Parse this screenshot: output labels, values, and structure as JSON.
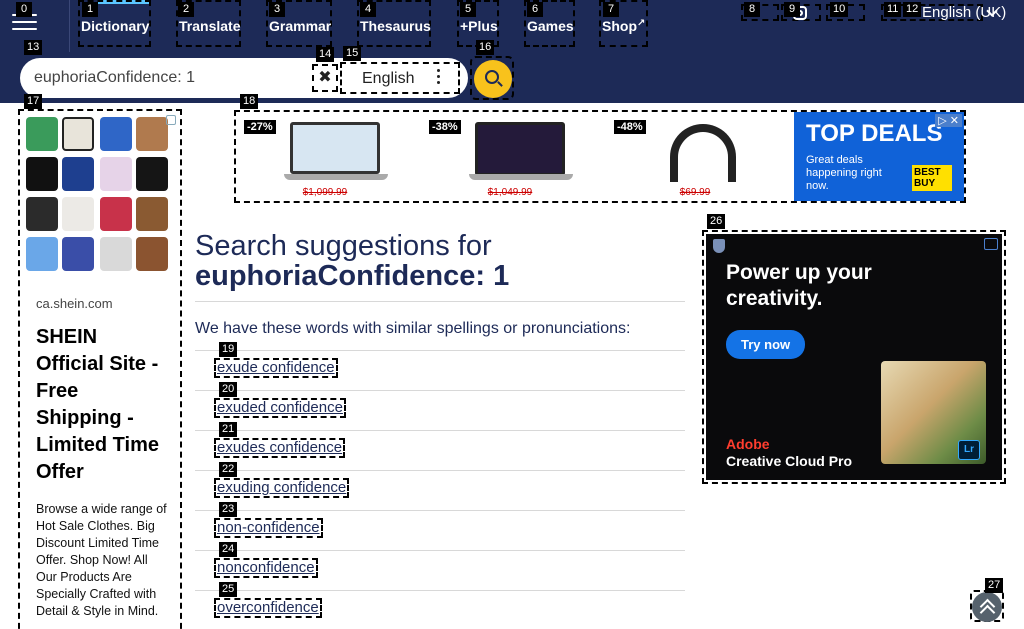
{
  "header": {
    "nav": [
      {
        "label": "Dictionary",
        "tag": "1"
      },
      {
        "label": "Translate",
        "tag": "2"
      },
      {
        "label": "Grammar",
        "tag": "3"
      },
      {
        "label": "Thesaurus",
        "tag": "4"
      },
      {
        "label": "+Plus",
        "tag": "5"
      },
      {
        "label": "Games",
        "tag": "6"
      },
      {
        "label": "Shop",
        "tag": "7"
      }
    ],
    "language": "English (UK)",
    "tags": {
      "menu": "0",
      "social_1": "8",
      "social_2": "9",
      "social_3": "10",
      "lang_a": "11",
      "lang_b": "12"
    }
  },
  "search": {
    "query": "euphoriaConfidence: 1",
    "language": "English",
    "tags": {
      "field": "13",
      "clear": "14",
      "language": "15",
      "go": "16"
    }
  },
  "left_ad": {
    "tag": "17",
    "domain": "ca.shein.com",
    "headline": "SHEIN Official Site - Free Shipping - Limited Time Offer",
    "body": "Browse a wide range of Hot Sale Clothes. Big Discount Limited Time Offer. Shop Now! All Our Products Are Specially Crafted with Detail & Style in Mind."
  },
  "banner_ad": {
    "tag": "18",
    "products": [
      {
        "discount": "-27%",
        "price": "$1,099.99"
      },
      {
        "discount": "-38%",
        "price": "$1,049.99"
      },
      {
        "discount": "-48%",
        "price": "$69.99"
      }
    ],
    "deal_title": "TOP DEALS",
    "deal_subtitle": "Great deals happening right now.",
    "deal_brand": "BEST BUY"
  },
  "main": {
    "title": "Search suggestions for",
    "query": "euphoriaConfidence: 1",
    "note": "We have these words with similar spellings or pronunciations:",
    "suggestions": [
      {
        "text": "exude confidence",
        "tag": "19"
      },
      {
        "text": "exuded confidence",
        "tag": "20"
      },
      {
        "text": "exudes confidence",
        "tag": "21"
      },
      {
        "text": "exuding confidence",
        "tag": "22"
      },
      {
        "text": "non-confidence",
        "tag": "23"
      },
      {
        "text": "nonconfidence",
        "tag": "24"
      },
      {
        "text": "overconfidence",
        "tag": "25"
      }
    ]
  },
  "right_ad": {
    "tag": "26",
    "headline": "Power up your creativity.",
    "cta": "Try now",
    "brand_1": "Adobe",
    "brand_2": "Creative Cloud Pro",
    "app": "Lr"
  },
  "scroll_top": {
    "tag": "27"
  },
  "colors": {
    "header": "#1d2a57",
    "accent": "#f8c21c",
    "link": "#1d2a57"
  }
}
